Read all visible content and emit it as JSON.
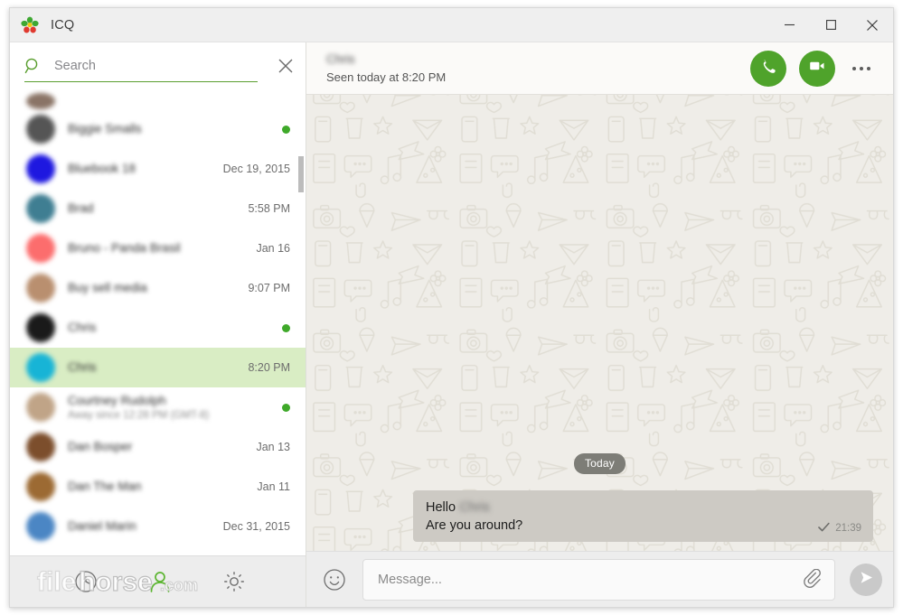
{
  "window": {
    "title": "ICQ",
    "logo_icon": "icq-flower-icon",
    "controls": {
      "minimize_label": "Minimize",
      "maximize_label": "Maximize",
      "close_label": "Close"
    }
  },
  "search": {
    "placeholder": "Search",
    "value": "",
    "icon": "search-icon",
    "close_icon": "close-icon"
  },
  "contacts": [
    {
      "name": "",
      "meta": "",
      "sub": "",
      "online": false,
      "selected": false,
      "partial": true,
      "avatar_color": "#8a7466"
    },
    {
      "name": "Biggie Smalls",
      "meta": "",
      "sub": "",
      "online": true,
      "selected": false,
      "partial": false,
      "avatar_color": "#555555"
    },
    {
      "name": "Bluebook 18",
      "meta": "Dec 19, 2015",
      "sub": "",
      "online": false,
      "selected": false,
      "partial": false,
      "avatar_color": "#1e18e0"
    },
    {
      "name": "Brad",
      "meta": "5:58 PM",
      "sub": "",
      "online": false,
      "selected": false,
      "partial": false,
      "avatar_color": "#3f7e92"
    },
    {
      "name": "Bruno - Panda Brasil",
      "meta": "Jan 16",
      "sub": "",
      "online": false,
      "selected": false,
      "partial": false,
      "avatar_color": "#fc6d6d"
    },
    {
      "name": "Buy sell media",
      "meta": "9:07 PM",
      "sub": "",
      "online": false,
      "selected": false,
      "partial": false,
      "avatar_color": "#b98f6f"
    },
    {
      "name": "Chris",
      "meta": "",
      "sub": "",
      "online": true,
      "selected": false,
      "partial": false,
      "avatar_color": "#1a1a1a"
    },
    {
      "name": "Chris",
      "meta": "8:20 PM",
      "sub": "",
      "online": false,
      "selected": true,
      "partial": false,
      "avatar_color": "#17b4d6"
    },
    {
      "name": "Courtney Rudolph",
      "meta": "",
      "sub": "Away since 12:28 PM (GMT-8)",
      "online": true,
      "selected": false,
      "partial": false,
      "avatar_color": "#c0a487"
    },
    {
      "name": "Dan Bosper",
      "meta": "Jan 13",
      "sub": "",
      "online": false,
      "selected": false,
      "partial": false,
      "avatar_color": "#7c4e2c"
    },
    {
      "name": "Dan The Man",
      "meta": "Jan 11",
      "sub": "",
      "online": false,
      "selected": false,
      "partial": false,
      "avatar_color": "#9c6a33"
    },
    {
      "name": "Daniel Marin",
      "meta": "Dec 31, 2015",
      "sub": "",
      "online": false,
      "selected": false,
      "partial": false,
      "avatar_color": "#4b86c4"
    }
  ],
  "sidebar_toolbar": {
    "history_icon": "clock-history-icon",
    "contacts_icon": "person-icon",
    "settings_icon": "gear-icon"
  },
  "watermark": {
    "text_1": "file",
    "text_2": "horse",
    "text_3": ".com"
  },
  "chat": {
    "contact_name": "Chris",
    "status": "Seen today at 8:20 PM",
    "call_icon": "phone-icon",
    "video_icon": "video-camera-icon",
    "more_icon": "more-horizontal-icon",
    "day_divider": "Today",
    "messages": [
      {
        "line1_prefix": "Hello",
        "line1_name": "Chris",
        "line2": "Are you around?",
        "time": "21:39",
        "status_icon": "single-check-icon"
      }
    ]
  },
  "composer": {
    "smiley_icon": "smiley-icon",
    "placeholder": "Message...",
    "value": "",
    "attach_icon": "paperclip-icon",
    "send_icon": "send-icon"
  },
  "colors": {
    "brand_green": "#4fa32b",
    "selected_row": "#d9edc4",
    "online_dot": "#3fa92a",
    "wallpaper": "#efede8",
    "bubble": "#cdcac4",
    "day_pill": "#7d7d77"
  }
}
